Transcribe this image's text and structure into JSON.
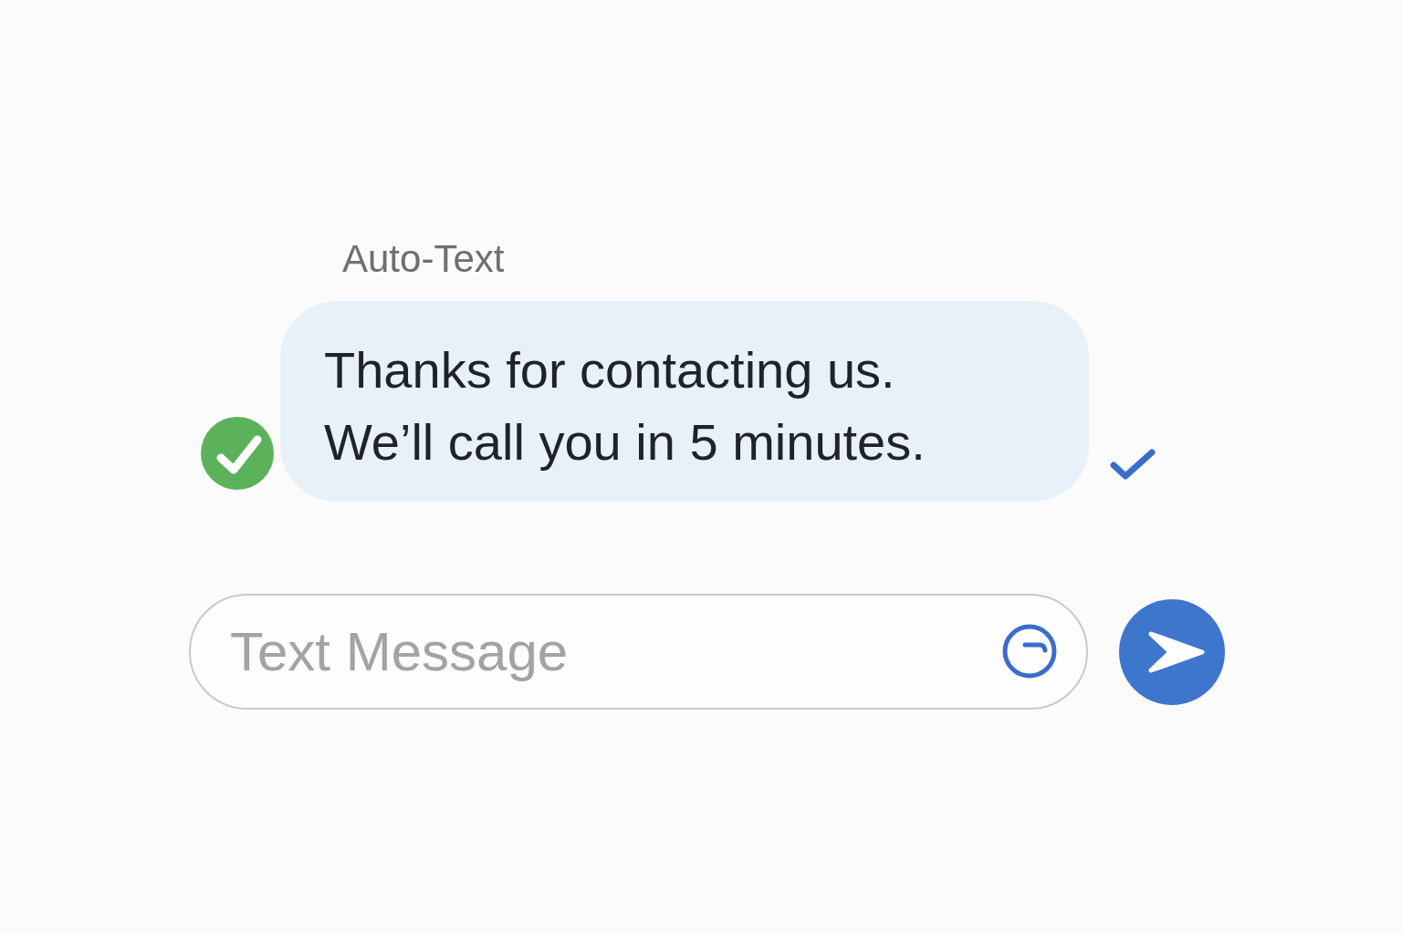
{
  "label": "Auto-Text",
  "message": {
    "lines": [
      "Thanks for contacting us.",
      "We’ll call you in 5 minutes."
    ],
    "delivered": true
  },
  "composer": {
    "placeholder": "Text Message"
  }
}
